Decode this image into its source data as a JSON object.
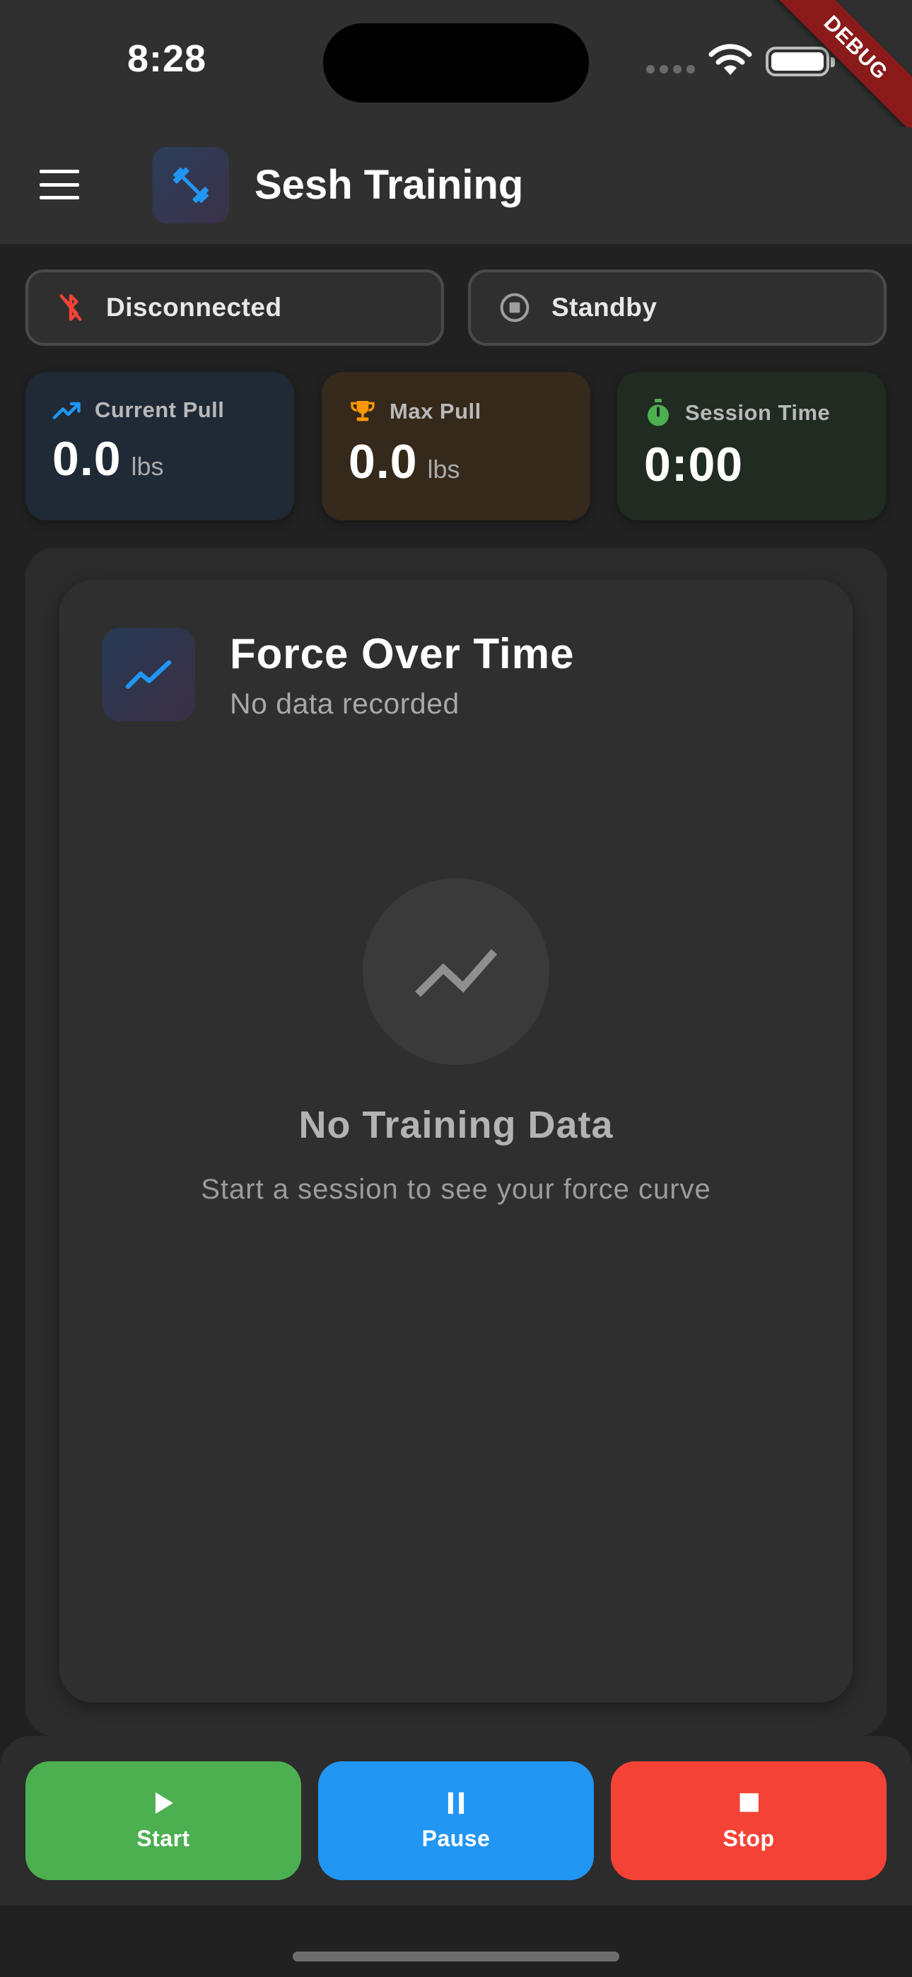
{
  "status_bar": {
    "time": "8:28",
    "debug_label": "DEBUG"
  },
  "app_bar": {
    "title": "Sesh Training",
    "menu_icon": "hamburger-menu-icon",
    "logo_icon": "dumbbell-icon"
  },
  "connection": {
    "label": "Disconnected",
    "icon": "bluetooth-disabled-icon",
    "color": "#f44336"
  },
  "session_state": {
    "label": "Standby",
    "icon": "stop-circle-icon"
  },
  "stats": {
    "current_pull": {
      "label": "Current Pull",
      "value": "0.0",
      "unit": "lbs",
      "icon": "trending-up-icon",
      "color": "#2196f3"
    },
    "max_pull": {
      "label": "Max Pull",
      "value": "0.0",
      "unit": "lbs",
      "icon": "trophy-icon",
      "color": "#ff9800"
    },
    "session_time": {
      "label": "Session Time",
      "value": "0:00",
      "icon": "stopwatch-icon",
      "color": "#4caf50"
    }
  },
  "chart": {
    "title": "Force Over Time",
    "subtitle": "No data recorded",
    "icon": "show-chart-icon",
    "empty_title": "No Training Data",
    "empty_subtitle": "Start a session to see your force curve"
  },
  "controls": {
    "start_label": "Start",
    "pause_label": "Pause",
    "stop_label": "Stop",
    "start_color": "#4caf50",
    "pause_color": "#2196f3",
    "stop_color": "#f44336"
  }
}
